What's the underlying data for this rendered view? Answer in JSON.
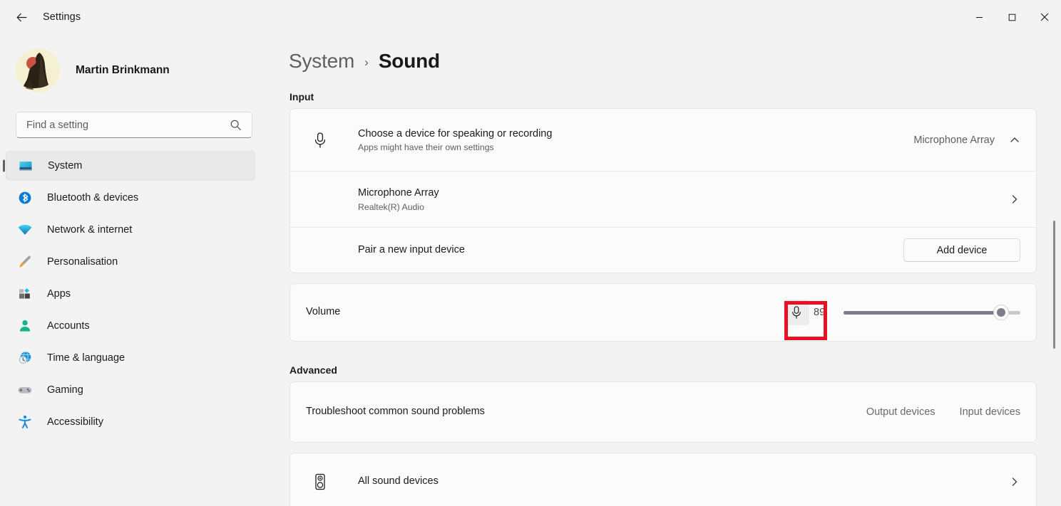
{
  "window": {
    "app_title": "Settings",
    "back_icon": "back-arrow-icon",
    "minimize_icon": "minimize-icon",
    "maximize_icon": "maximize-icon",
    "close_icon": "close-icon"
  },
  "sidebar": {
    "profile": {
      "name": "Martin Brinkmann",
      "avatar_icon": "user-avatar"
    },
    "search": {
      "placeholder": "Find a setting",
      "value": "",
      "icon": "search-icon"
    },
    "items": [
      {
        "label": "System",
        "icon": "monitor-icon",
        "selected": true
      },
      {
        "label": "Bluetooth & devices",
        "icon": "bluetooth-icon",
        "selected": false
      },
      {
        "label": "Network & internet",
        "icon": "wifi-icon",
        "selected": false
      },
      {
        "label": "Personalisation",
        "icon": "paintbrush-icon",
        "selected": false
      },
      {
        "label": "Apps",
        "icon": "apps-icon",
        "selected": false
      },
      {
        "label": "Accounts",
        "icon": "person-icon",
        "selected": false
      },
      {
        "label": "Time & language",
        "icon": "clock-globe-icon",
        "selected": false
      },
      {
        "label": "Gaming",
        "icon": "gamepad-icon",
        "selected": false
      },
      {
        "label": "Accessibility",
        "icon": "accessibility-icon",
        "selected": false
      }
    ]
  },
  "breadcrumb": {
    "parent": "System",
    "separator": "›",
    "current": "Sound"
  },
  "main": {
    "input_section": {
      "title": "Input",
      "choose_device": {
        "icon": "microphone-icon",
        "title": "Choose a device for speaking or recording",
        "subtitle": "Apps might have their own settings",
        "selected_device": "Microphone Array",
        "expander_icon": "chevron-up-icon"
      },
      "device_row": {
        "title": "Microphone Array",
        "subtitle": "Realtek(R) Audio",
        "chevron_icon": "chevron-right-icon"
      },
      "pair_row": {
        "title": "Pair a new input device",
        "button_label": "Add device"
      }
    },
    "volume_card": {
      "label": "Volume",
      "mute_button_icon": "microphone-icon",
      "value": "89",
      "slider": {
        "min": 0,
        "max": 100,
        "value": 89
      }
    },
    "advanced_section": {
      "title": "Advanced",
      "troubleshoot": {
        "title": "Troubleshoot common sound problems",
        "output_label": "Output devices",
        "input_label": "Input devices"
      },
      "all_sound_devices": {
        "icon": "speaker-icon",
        "title": "All sound devices",
        "chevron_icon": "chevron-right-icon"
      }
    }
  },
  "annotation": {
    "target": "mute-microphone-button",
    "color": "#e81123"
  },
  "colors": {
    "window_bg": "#f3f3f3",
    "card_bg": "#fbfbfb",
    "card_border": "#e5e5e5",
    "selected_nav_bg": "#e9e9e9",
    "accent_indicator": "#616161",
    "slider_fill": "#7b7d8b",
    "slider_track": "#c8c8cd",
    "highlight": "#e81123"
  }
}
